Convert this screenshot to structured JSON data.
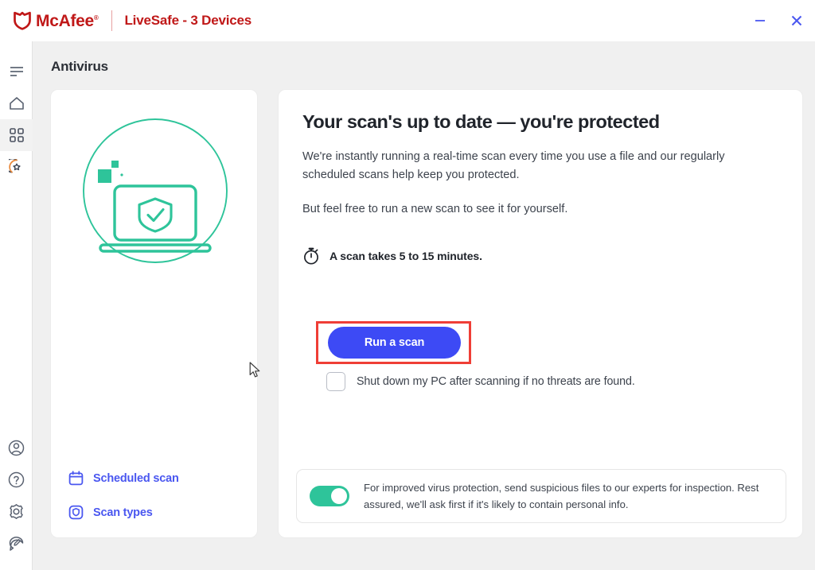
{
  "window": {
    "brand_name": "McAfee",
    "brand_tm": "®",
    "product": "LiveSafe - 3 Devices",
    "minimize_label": "Minimize",
    "close_label": "Close"
  },
  "sidebar": {
    "top_items": [
      {
        "name": "menu-icon",
        "label": "Menu",
        "selected": false
      },
      {
        "name": "home-icon",
        "label": "Home",
        "selected": false
      },
      {
        "name": "grid-icon",
        "label": "My Protection",
        "selected": true
      },
      {
        "name": "security-badge-icon",
        "label": "Protection Score",
        "selected": false
      }
    ],
    "bottom_items": [
      {
        "name": "account-icon",
        "label": "My Account",
        "selected": false
      },
      {
        "name": "help-icon",
        "label": "Help",
        "selected": false
      },
      {
        "name": "settings-gear-icon",
        "label": "Settings",
        "selected": false
      },
      {
        "name": "feedback-icon",
        "label": "Feedback",
        "selected": false
      }
    ]
  },
  "page": {
    "title": "Antivirus"
  },
  "left_card": {
    "illustration": "laptop-shield-check-illustration",
    "links": [
      {
        "icon": "calendar-icon",
        "label": "Scheduled scan"
      },
      {
        "icon": "scan-shield-icon",
        "label": "Scan types"
      }
    ]
  },
  "right_card": {
    "headline": "Your scan's up to date — you're protected",
    "paragraph1": "We're instantly running a real-time scan every time you use a file and our regularly scheduled scans help keep you protected.",
    "paragraph2": "But feel free to run a new scan to see it for yourself.",
    "duration_icon": "stopwatch-icon",
    "duration_text": "A scan takes 5 to 15 minutes.",
    "scan_button_label": "Run a scan",
    "shutdown_checkbox": {
      "label": "Shut down my PC after scanning if no threats are found.",
      "checked": false
    },
    "banner": {
      "toggle_on": true,
      "text": "For improved virus protection, send suspicious files to our experts for inspection. Rest assured, we'll ask first if it's likely to contain personal info."
    }
  },
  "annotation": {
    "type": "highlight-box",
    "target": "run-a-scan-button",
    "color": "#ef3e36"
  },
  "colors": {
    "brand_red": "#C01818",
    "accent_blue": "#3d4af5",
    "teal": "#2ec49a",
    "page_bg": "#f0f0f0",
    "highlight_red": "#ef3e36"
  }
}
